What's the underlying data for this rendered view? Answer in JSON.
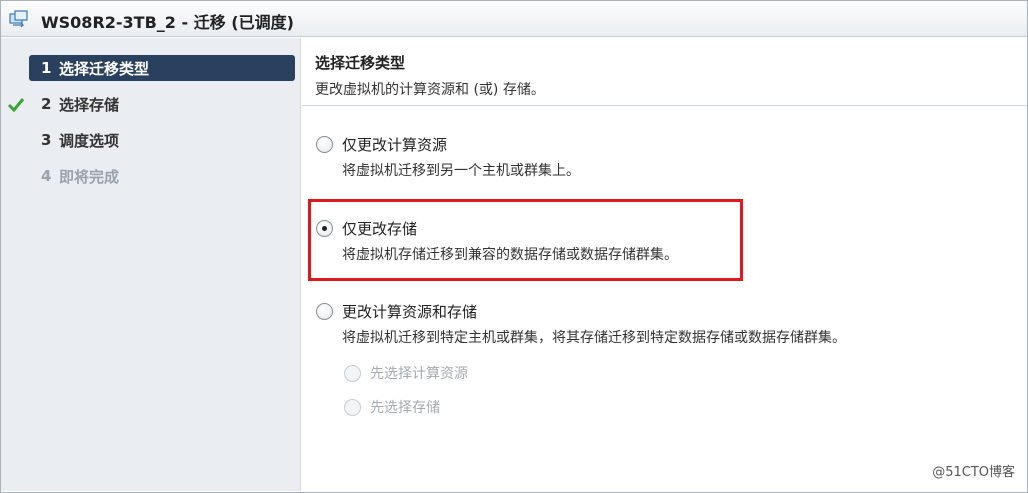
{
  "window": {
    "title": "WS08R2-3TB_2 - 迁移 (已调度)",
    "title_icon": "vm-migrate-icon"
  },
  "sidebar": {
    "steps": [
      {
        "number": "1",
        "label": "选择迁移类型",
        "state": "active",
        "completed": true
      },
      {
        "number": "2",
        "label": "选择存储",
        "state": "normal"
      },
      {
        "number": "3",
        "label": "调度选项",
        "state": "normal"
      },
      {
        "number": "4",
        "label": "即将完成",
        "state": "disabled"
      }
    ]
  },
  "main": {
    "title": "选择迁移类型",
    "subtitle": "更改虚拟机的计算资源和 (或) 存储。",
    "options": [
      {
        "label": "仅更改计算资源",
        "description": "将虚拟机迁移到另一个主机或群集上。",
        "selected": false
      },
      {
        "label": "仅更改存储",
        "description": "将虚拟机存储迁移到兼容的数据存储或数据存储群集。",
        "selected": true
      },
      {
        "label": "更改计算资源和存储",
        "description": "将虚拟机迁移到特定主机或群集，将其存储迁移到特定数据存储或数据存储群集。",
        "selected": false
      }
    ],
    "sub_options": [
      {
        "label": "先选择计算资源",
        "enabled": false
      },
      {
        "label": "先选择存储",
        "enabled": false
      }
    ]
  },
  "watermark": "@51CTO博客",
  "colors": {
    "active_step_bg": "#29405f",
    "highlight_border": "#e0191e",
    "check_green": "#3aa43a"
  }
}
